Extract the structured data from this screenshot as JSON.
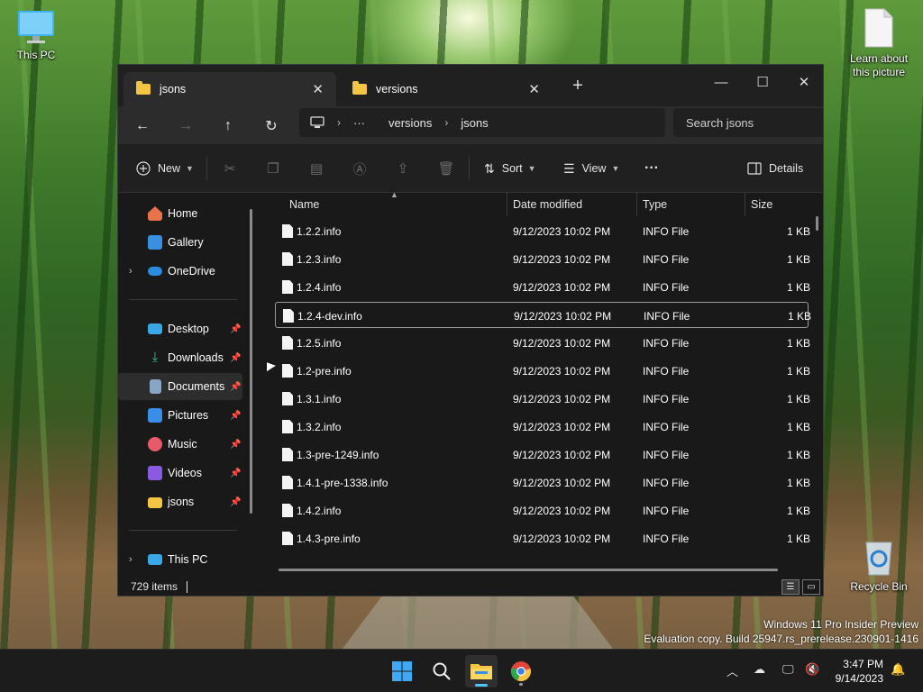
{
  "desktop": {
    "icons": [
      {
        "label": "This PC"
      },
      {
        "label": "Learn about this picture"
      },
      {
        "label": "Recycle Bin"
      }
    ],
    "watermark_line1": "Windows 11 Pro Insider Preview",
    "watermark_line2": "Evaluation copy. Build 25947.rs_prerelease.230901-1416"
  },
  "window": {
    "tabs": [
      {
        "label": "jsons",
        "active": true
      },
      {
        "label": "versions",
        "active": false
      }
    ],
    "new_tab_glyph": "+",
    "controls": {
      "minimize": "—",
      "maximize": "☐",
      "close": "✕"
    },
    "address": {
      "crumbs": [
        "versions",
        "jsons"
      ],
      "overflow": "···"
    },
    "search_placeholder": "Search jsons",
    "toolbar": {
      "new_label": "New",
      "sort_label": "Sort",
      "view_label": "View",
      "more_glyph": "···",
      "details_label": "Details"
    },
    "sidebar": {
      "items": [
        {
          "label": "Home",
          "icon": "home-icon",
          "color": "#e8734a"
        },
        {
          "label": "Gallery",
          "icon": "gallery-icon",
          "color": "#3b8fe0"
        },
        {
          "label": "OneDrive",
          "icon": "cloud-icon",
          "color": "#2a8be0"
        },
        {
          "label": "Desktop",
          "icon": "desktop-icon",
          "color": "#3ba7e6"
        },
        {
          "label": "Downloads",
          "icon": "download-icon",
          "color": "#3fbf8a"
        },
        {
          "label": "Documents",
          "icon": "document-icon",
          "color": "#8aa4c4"
        },
        {
          "label": "Pictures",
          "icon": "pictures-icon",
          "color": "#3a8ee8"
        },
        {
          "label": "Music",
          "icon": "music-icon",
          "color": "#e85a6a"
        },
        {
          "label": "Videos",
          "icon": "videos-icon",
          "color": "#8a5ae0"
        },
        {
          "label": "jsons",
          "icon": "folder-icon",
          "color": "#f4c542"
        },
        {
          "label": "This PC",
          "icon": "pc-icon",
          "color": "#3ba7e6"
        }
      ],
      "selected": "Documents"
    },
    "columns": [
      "Name",
      "Date modified",
      "Type",
      "Size"
    ],
    "files": [
      {
        "name": "1.2.2.info",
        "date": "9/12/2023 10:02 PM",
        "type": "INFO File",
        "size": "1 KB"
      },
      {
        "name": "1.2.3.info",
        "date": "9/12/2023 10:02 PM",
        "type": "INFO File",
        "size": "1 KB"
      },
      {
        "name": "1.2.4.info",
        "date": "9/12/2023 10:02 PM",
        "type": "INFO File",
        "size": "1 KB"
      },
      {
        "name": "1.2.4-dev.info",
        "date": "9/12/2023 10:02 PM",
        "type": "INFO File",
        "size": "1 KB"
      },
      {
        "name": "1.2.5.info",
        "date": "9/12/2023 10:02 PM",
        "type": "INFO File",
        "size": "1 KB"
      },
      {
        "name": "1.2-pre.info",
        "date": "9/12/2023 10:02 PM",
        "type": "INFO File",
        "size": "1 KB"
      },
      {
        "name": "1.3.1.info",
        "date": "9/12/2023 10:02 PM",
        "type": "INFO File",
        "size": "1 KB"
      },
      {
        "name": "1.3.2.info",
        "date": "9/12/2023 10:02 PM",
        "type": "INFO File",
        "size": "1 KB"
      },
      {
        "name": "1.3-pre-1249.info",
        "date": "9/12/2023 10:02 PM",
        "type": "INFO File",
        "size": "1 KB"
      },
      {
        "name": "1.4.1-pre-1338.info",
        "date": "9/12/2023 10:02 PM",
        "type": "INFO File",
        "size": "1 KB"
      },
      {
        "name": "1.4.2.info",
        "date": "9/12/2023 10:02 PM",
        "type": "INFO File",
        "size": "1 KB"
      },
      {
        "name": "1.4.3-pre.info",
        "date": "9/12/2023 10:02 PM",
        "type": "INFO File",
        "size": "1 KB"
      }
    ],
    "focused_file": "1.2.4-dev.info",
    "status": "729 items"
  },
  "taskbar": {
    "time": "3:47 PM",
    "date": "9/14/2023"
  }
}
